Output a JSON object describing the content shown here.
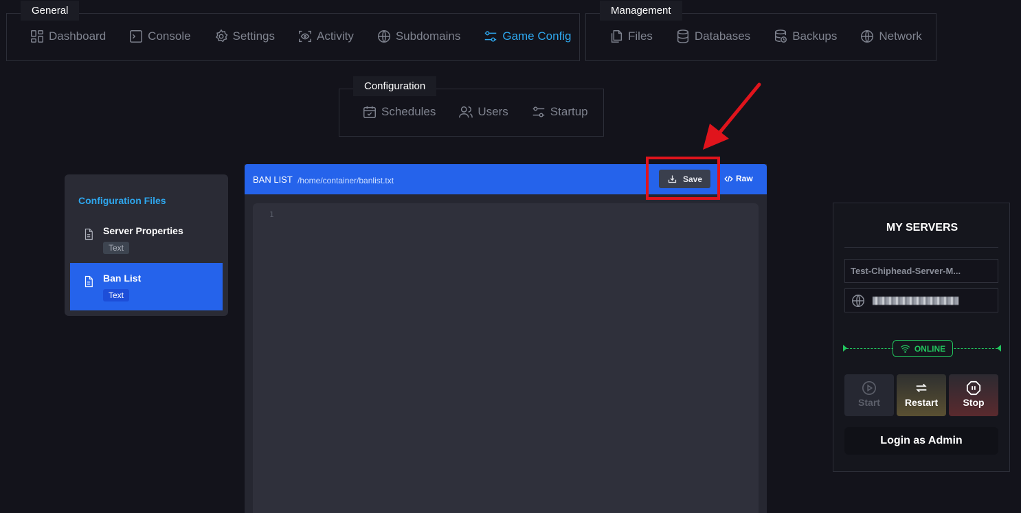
{
  "nav": {
    "general": {
      "title": "General",
      "items": [
        {
          "label": "Dashboard",
          "icon": "dashboard-icon"
        },
        {
          "label": "Console",
          "icon": "console-icon"
        },
        {
          "label": "Settings",
          "icon": "gear-icon"
        },
        {
          "label": "Activity",
          "icon": "eye-icon"
        },
        {
          "label": "Subdomains",
          "icon": "globe-icon"
        },
        {
          "label": "Game Config",
          "icon": "sliders-icon",
          "active": true
        }
      ]
    },
    "management": {
      "title": "Management",
      "items": [
        {
          "label": "Files",
          "icon": "files-icon"
        },
        {
          "label": "Databases",
          "icon": "database-icon"
        },
        {
          "label": "Backups",
          "icon": "backup-icon"
        },
        {
          "label": "Network",
          "icon": "globe-icon"
        }
      ]
    },
    "configuration": {
      "title": "Configuration",
      "items": [
        {
          "label": "Schedules",
          "icon": "calendar-icon"
        },
        {
          "label": "Users",
          "icon": "users-icon"
        },
        {
          "label": "Startup",
          "icon": "sliders-icon"
        }
      ]
    }
  },
  "config_files": {
    "title": "Configuration Files",
    "items": [
      {
        "name": "Server Properties",
        "type": "Text"
      },
      {
        "name": "Ban List",
        "type": "Text",
        "selected": true
      }
    ]
  },
  "editor": {
    "title": "BAN LIST",
    "path": "/home/container/banlist.txt",
    "save_label": "Save",
    "raw_label": "Raw",
    "line_number": "1"
  },
  "servers": {
    "title": "MY SERVERS",
    "server_name": "Test-Chiphead-Server-M...",
    "status": "ONLINE",
    "start_label": "Start",
    "restart_label": "Restart",
    "stop_label": "Stop",
    "admin_label": "Login as Admin"
  },
  "colors": {
    "background": "#13131b",
    "accent": "#2ea7ee",
    "primary": "#2563eb",
    "online": "#22c55e",
    "highlight": "#e0141c"
  }
}
